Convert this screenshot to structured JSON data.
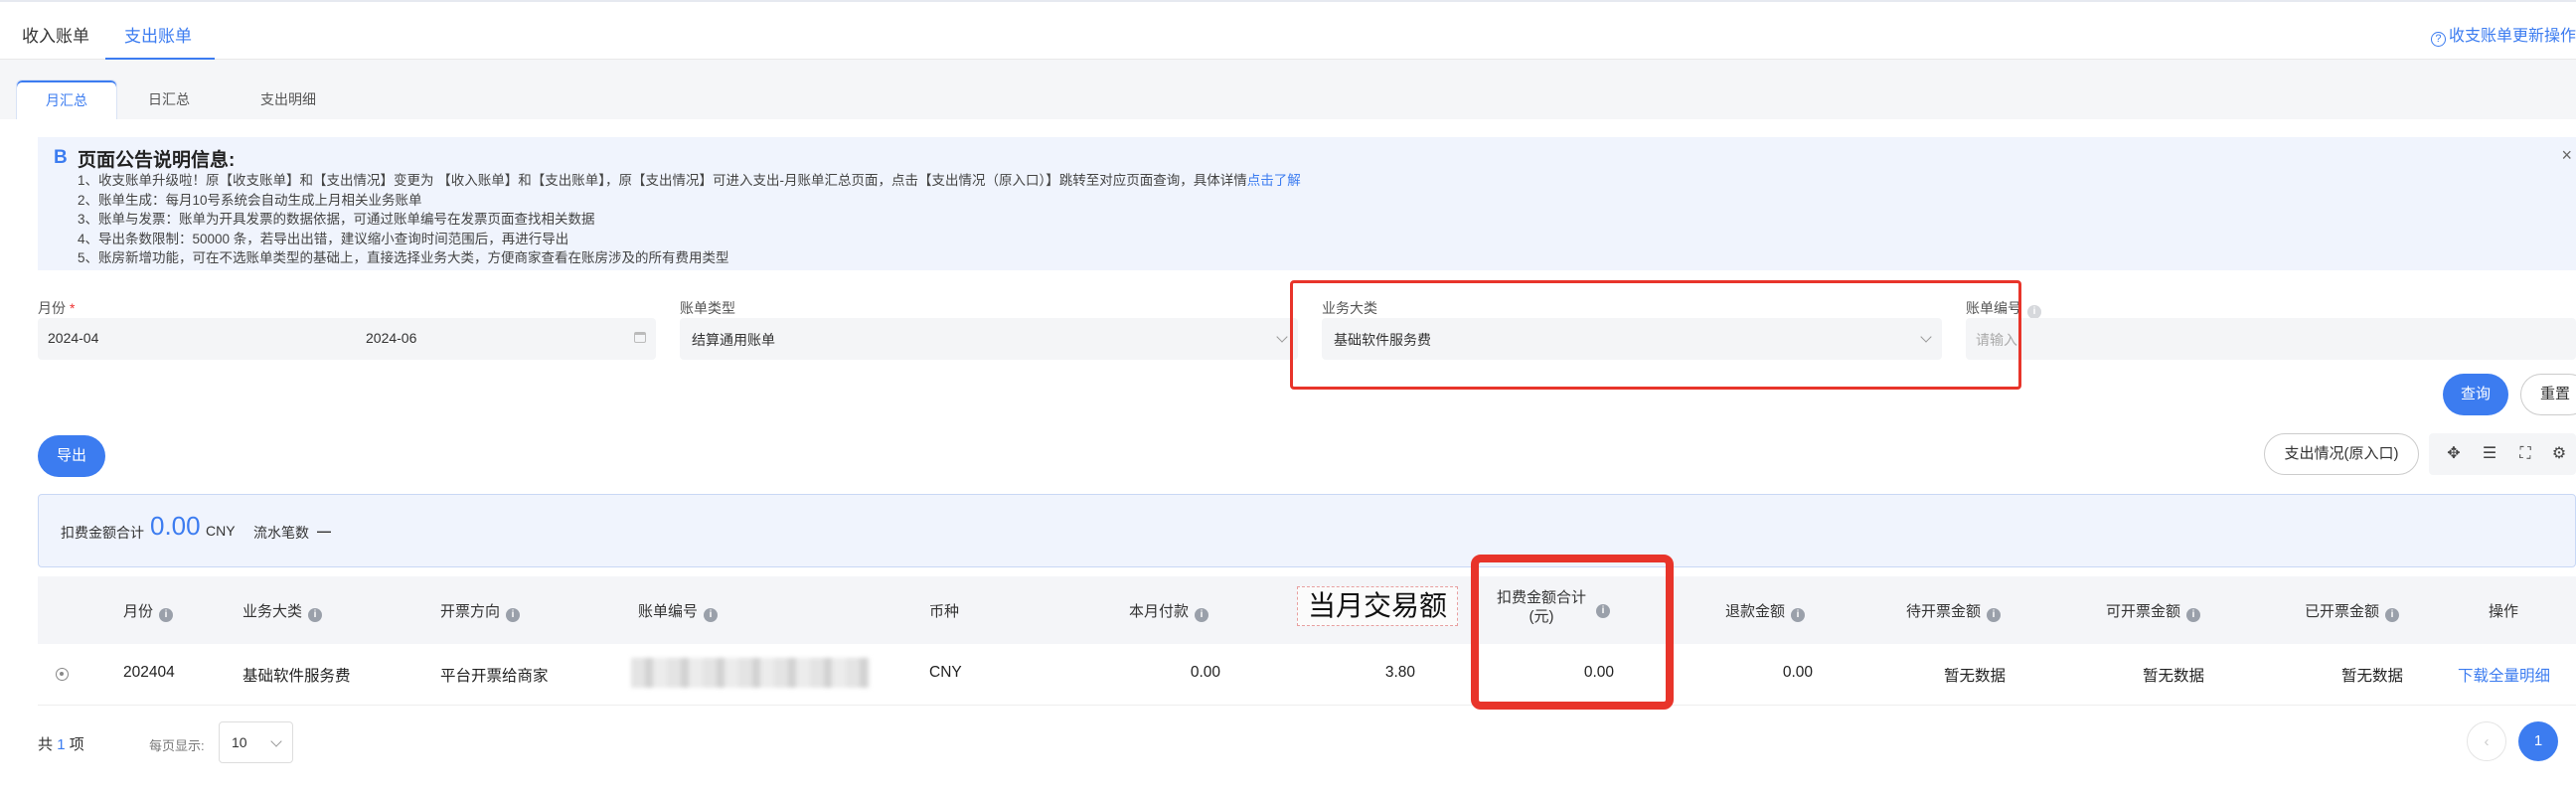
{
  "top_tabs": [
    {
      "label": "收入账单"
    },
    {
      "label": "支出账单"
    }
  ],
  "help_link": "收支账单更新操作",
  "sub_tabs": [
    {
      "label": "月汇总"
    },
    {
      "label": "日汇总"
    },
    {
      "label": "支出明细"
    }
  ],
  "notice": {
    "icon_char": "B",
    "title": "页面公告说明信息:",
    "close": "×",
    "lines": [
      "1、收支账单升级啦！原【收支账单】和【支出情况】变更为 【收入账单】和【支出账单】，原【支出情况】可进入支出-月账单汇总页面，点击【支出情况（原入口）】跳转至对应页面查询，具体详情",
      "2、账单生成：每月10号系统会自动生成上月相关业务账单",
      "3、账单与发票：账单为开具发票的数据依据，可通过账单编号在发票页面查找相关数据",
      "4、导出条数限制：50000 条，若导出出错，建议缩小查询时间范围后，再进行导出",
      "5、账房新增功能，可在不选账单类型的基础上，直接选择业务大类，方便商家查看在账房涉及的所有费用类型"
    ],
    "link_text": "点击了解"
  },
  "filters": {
    "month_label": "月份",
    "required_mark": "*",
    "month_start": "2024-04",
    "month_end": "2024-06",
    "bill_type_label": "账单类型",
    "bill_type_value": "结算通用账单",
    "biz_label": "业务大类",
    "biz_value": "基础软件服务费",
    "bill_no_label": "账单编号",
    "bill_no_placeholder": "请输入"
  },
  "buttons": {
    "query": "查询",
    "reset": "重置",
    "export": "导出",
    "old_entry": "支出情况(原入口)"
  },
  "summary": {
    "deduct_label": "扣费金额合计",
    "deduct_value": "0.00",
    "currency": "CNY",
    "flow_label": "流水笔数",
    "flow_value": "—"
  },
  "table": {
    "headers": {
      "month": "月份",
      "biz": "业务大类",
      "invoice_dir": "开票方向",
      "bill_no": "账单编号",
      "currency": "币种",
      "paid": "本月付款",
      "deduct_line1": "扣费金额合计",
      "deduct_line2": "(元)",
      "refund": "退款金额",
      "pending_invoice": "待开票金额",
      "available_invoice": "可开票金额",
      "invoiced": "已开票金额",
      "action": "操作"
    },
    "overlay_label": "当月交易额",
    "row": {
      "month": "202404",
      "biz": "基础软件服务费",
      "invoice_dir": "平台开票给商家",
      "currency": "CNY",
      "paid": "0.00",
      "trade": "3.80",
      "deduct": "0.00",
      "refund": "0.00",
      "pending_invoice": "暂无数据",
      "available_invoice": "暂无数据",
      "invoiced": "暂无数据",
      "action": "下载全量明细"
    }
  },
  "footer": {
    "total_prefix": "共",
    "total_count": "1",
    "total_suffix": "项",
    "per_page_label": "每页显示:",
    "per_page_value": "10",
    "current_page": "1"
  }
}
